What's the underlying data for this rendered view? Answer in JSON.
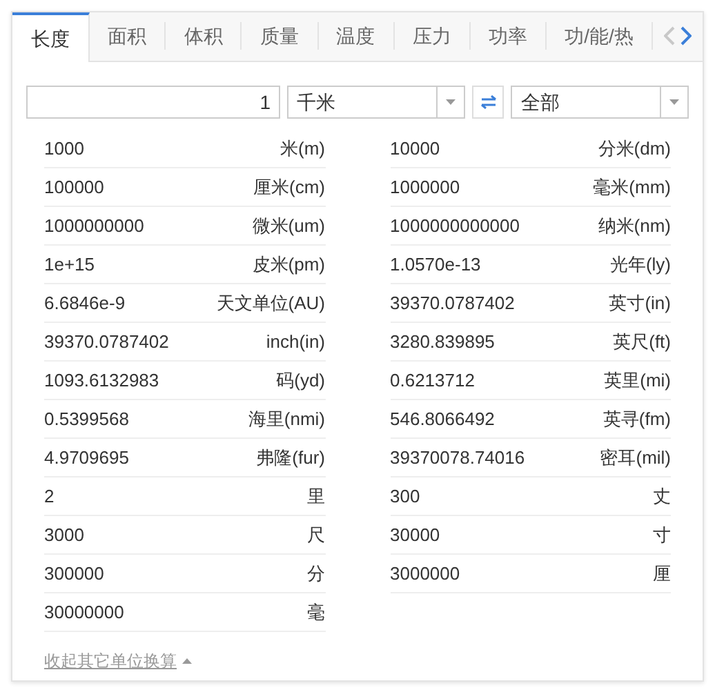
{
  "tabs": [
    {
      "label": "长度",
      "selected": true
    },
    {
      "label": "面积",
      "selected": false
    },
    {
      "label": "体积",
      "selected": false
    },
    {
      "label": "质量",
      "selected": false
    },
    {
      "label": "温度",
      "selected": false
    },
    {
      "label": "压力",
      "selected": false
    },
    {
      "label": "功率",
      "selected": false
    },
    {
      "label": "功/能/热",
      "selected": false
    }
  ],
  "tab_nav": {
    "prev_disabled": true,
    "next_disabled": false
  },
  "converter": {
    "amount": "1",
    "from_unit": "千米",
    "to_unit": "全部"
  },
  "results": [
    [
      {
        "value": "1000",
        "unit": "米(m)"
      },
      {
        "value": "100000",
        "unit": "厘米(cm)"
      },
      {
        "value": "1000000000",
        "unit": "微米(um)"
      },
      {
        "value": "1e+15",
        "unit": "皮米(pm)"
      },
      {
        "value": "6.6846e-9",
        "unit": "天文单位(AU)"
      },
      {
        "value": "39370.0787402",
        "unit": "inch(in)"
      },
      {
        "value": "1093.6132983",
        "unit": "码(yd)"
      },
      {
        "value": "0.5399568",
        "unit": "海里(nmi)"
      },
      {
        "value": "4.9709695",
        "unit": "弗隆(fur)"
      },
      {
        "value": "2",
        "unit": "里"
      },
      {
        "value": "3000",
        "unit": "尺"
      },
      {
        "value": "300000",
        "unit": "分"
      },
      {
        "value": "30000000",
        "unit": "毫"
      }
    ],
    [
      {
        "value": "10000",
        "unit": "分米(dm)"
      },
      {
        "value": "1000000",
        "unit": "毫米(mm)"
      },
      {
        "value": "1000000000000",
        "unit": "纳米(nm)"
      },
      {
        "value": "1.0570e-13",
        "unit": "光年(ly)"
      },
      {
        "value": "39370.0787402",
        "unit": "英寸(in)"
      },
      {
        "value": "3280.839895",
        "unit": "英尺(ft)"
      },
      {
        "value": "0.6213712",
        "unit": "英里(mi)"
      },
      {
        "value": "546.8066492",
        "unit": "英寻(fm)"
      },
      {
        "value": "39370078.74016",
        "unit": "密耳(mil)"
      },
      {
        "value": "300",
        "unit": "丈"
      },
      {
        "value": "30000",
        "unit": "寸"
      },
      {
        "value": "3000000",
        "unit": "厘"
      }
    ]
  ],
  "footer_link": {
    "label": "收起其它单位换算",
    "expanded": true
  }
}
